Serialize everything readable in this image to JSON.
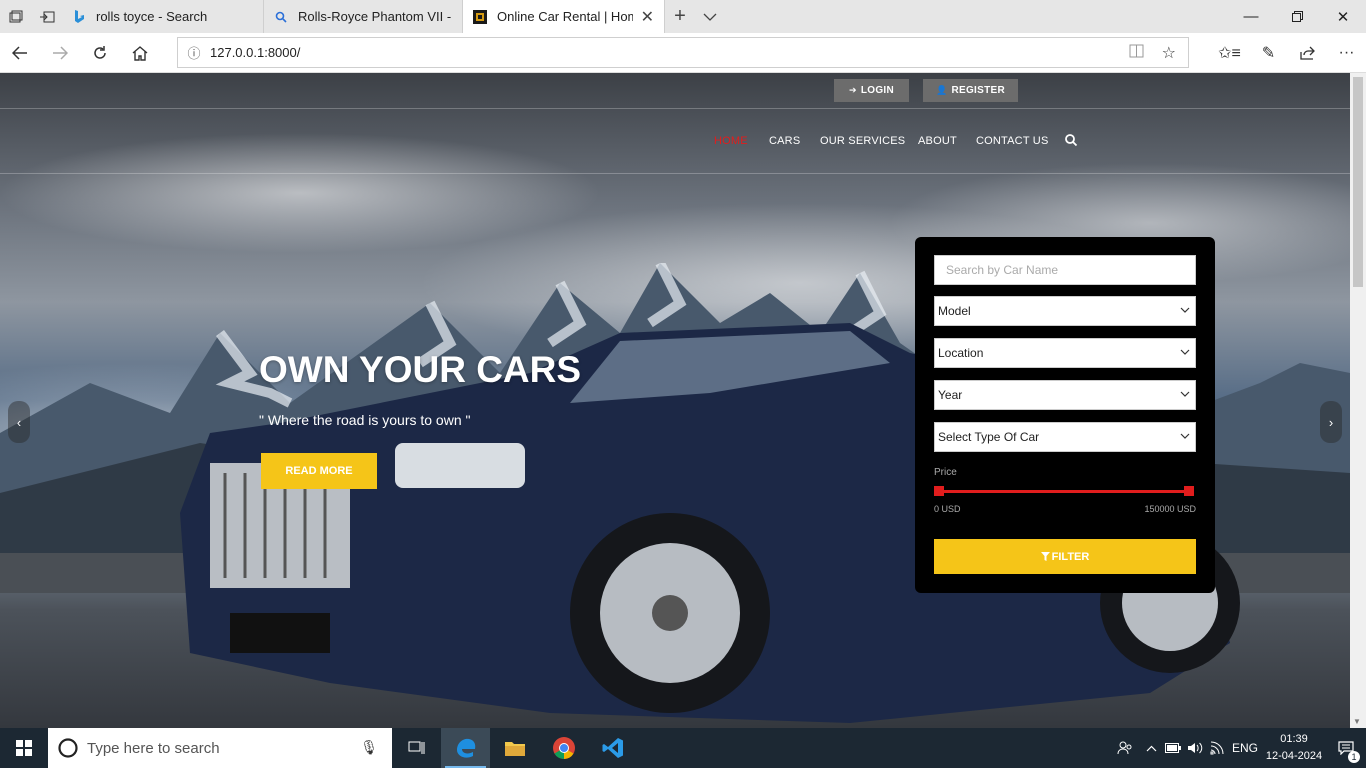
{
  "browser": {
    "tabs": [
      {
        "title": "rolls toyce - Search",
        "active": false
      },
      {
        "title": "Rolls-Royce Phantom VII - S",
        "active": false
      },
      {
        "title": "Online Car Rental | Hom",
        "active": true
      }
    ],
    "url": "127.0.0.1:8000/"
  },
  "site": {
    "login_label": "LOGIN",
    "register_label": "REGISTER",
    "nav": [
      {
        "label": "HOME",
        "active": true
      },
      {
        "label": "CARS",
        "active": false
      },
      {
        "label": "OUR SERVICES",
        "active": false
      },
      {
        "label": "ABOUT",
        "active": false
      },
      {
        "label": "CONTACT US",
        "active": false
      }
    ],
    "hero": {
      "title": "OWN YOUR CARS",
      "subtitle": "\" Where the road is yours to own \"",
      "button": "READ MORE"
    },
    "filter": {
      "search_placeholder": "Search by Car Name",
      "model": "Model",
      "location": "Location",
      "year": "Year",
      "type": "Select Type Of Car",
      "price_label": "Price",
      "price_min": "0 USD",
      "price_max": "150000 USD",
      "button": "FILTER"
    }
  },
  "taskbar": {
    "search_placeholder": "Type here to search",
    "lang": "ENG",
    "time": "01:39",
    "date": "12-04-2024",
    "notification_count": "1"
  },
  "colors": {
    "accent_yellow": "#f5c518",
    "accent_red": "#e11d1d",
    "taskbar": "#1c2833"
  }
}
